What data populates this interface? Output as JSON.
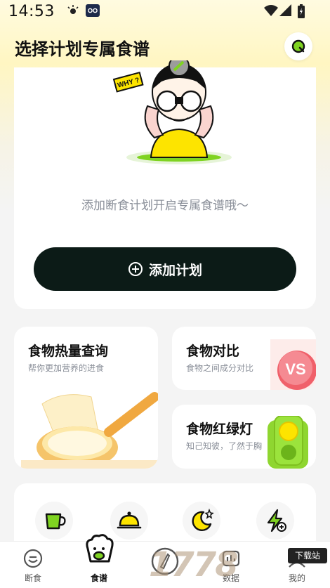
{
  "status_bar": {
    "time": "14:53"
  },
  "header": {
    "title": "选择计划专属食谱"
  },
  "plan_card": {
    "illustration_text": "WHY ?",
    "hint": "添加断食计划开启专属食谱哦～",
    "add_button_label": "添加计划"
  },
  "feature_cards": [
    {
      "title": "食物热量查询",
      "subtitle": "帮你更加营养的进食"
    },
    {
      "title": "食物对比",
      "subtitle": "食物之间成分对比",
      "badge": "VS"
    },
    {
      "title": "食物红绿灯",
      "subtitle": "知己知彼，了然于胸"
    }
  ],
  "tools": [
    {
      "icon": "cup-icon"
    },
    {
      "icon": "dish-cover-icon"
    },
    {
      "icon": "moon-star-icon"
    },
    {
      "icon": "lightning-plus-icon"
    }
  ],
  "tab_bar": {
    "tabs": [
      {
        "label": "断食",
        "icon": "fasting-icon"
      },
      {
        "label": "食谱",
        "icon": "recipe-icon",
        "active": true
      },
      {
        "label": "",
        "icon": "record-icon"
      },
      {
        "label": "数据",
        "icon": "data-icon"
      },
      {
        "label": "我的",
        "icon": "profile-icon"
      }
    ]
  },
  "watermark": {
    "text": "1778",
    "badge": "下载站"
  },
  "colors": {
    "accent": "#0c1b17",
    "green": "#7fd321",
    "yellow": "#fde400",
    "red": "#f0606a"
  }
}
